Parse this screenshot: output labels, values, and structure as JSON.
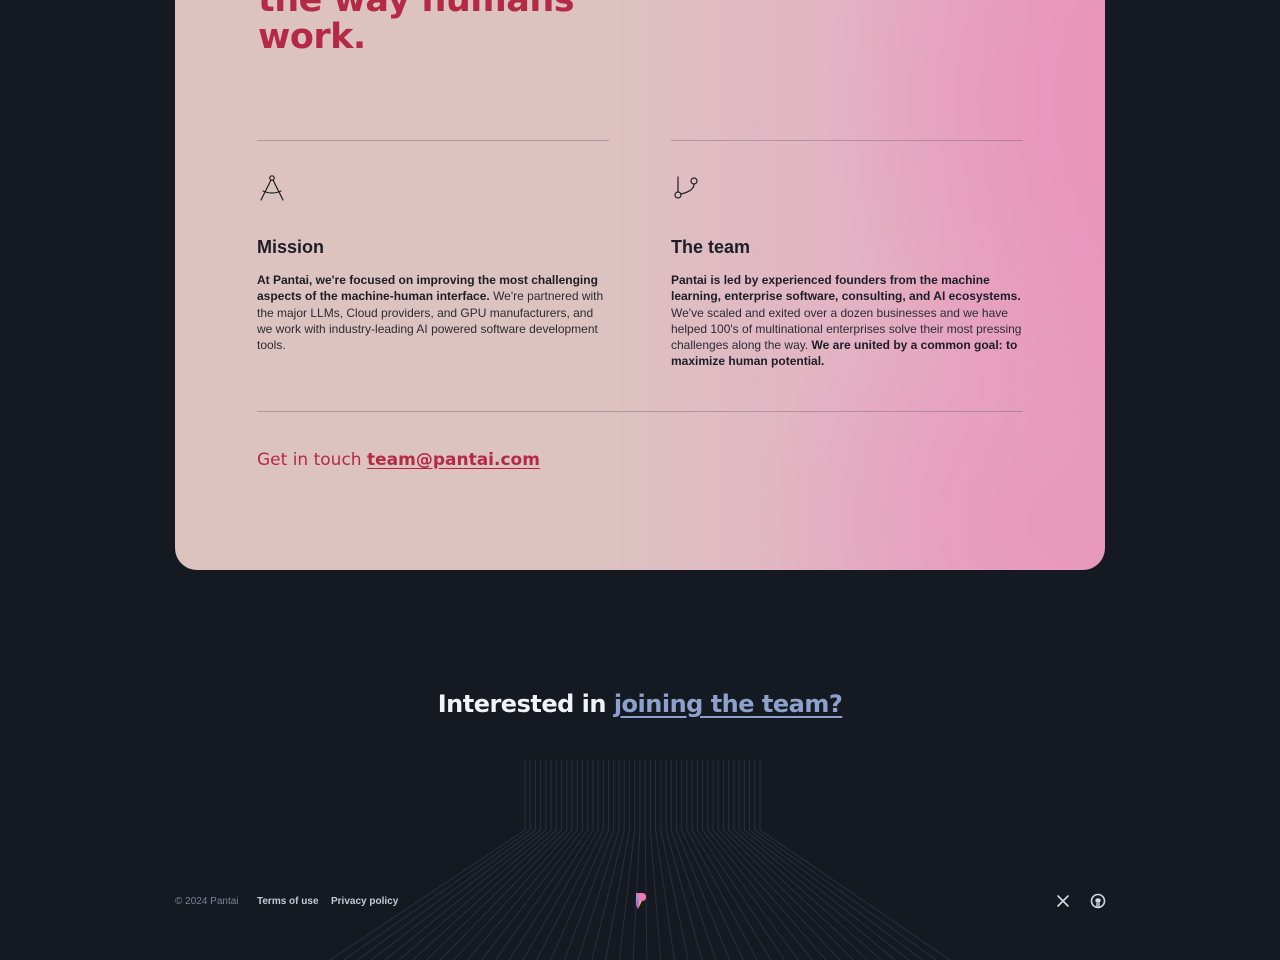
{
  "hero": {
    "headline_lines": [
      "the way humans",
      "work."
    ]
  },
  "columns": [
    {
      "icon": "compass-icon",
      "title": "Mission",
      "body_bold": "At Pantai, we're focused on improving the most challenging aspects of the machine-human interface.",
      "body_regular": " We're partnered with the major LLMs, Cloud providers, and GPU manufacturers, and we work with industry-leading AI powered software development tools."
    },
    {
      "icon": "git-branch-icon",
      "title": "The team",
      "body_bold": "Pantai is led by experienced founders from the machine learning, enterprise software, consulting, and AI ecosystems.",
      "body_regular": " We've scaled and exited over a dozen businesses and we have helped 100's of multinational enterprises solve their most pressing challenges along the way.",
      "body_bold_end": " We are united by a common goal: to maximize human potential."
    }
  ],
  "contact": {
    "label": "Get in touch",
    "email": "team@pantai.com"
  },
  "join": {
    "prefix": "Interested in",
    "link": "joining the team?"
  },
  "footer": {
    "copyright": "© 2024 Pantai",
    "terms": "Terms of use",
    "privacy": "Privacy policy",
    "logo_icon": "pantai-logo-icon",
    "social": [
      "x-icon",
      "github-icon"
    ]
  },
  "colors": {
    "background": "#141922",
    "accent": "#b42a44",
    "join_link": "#8ea0cc"
  }
}
